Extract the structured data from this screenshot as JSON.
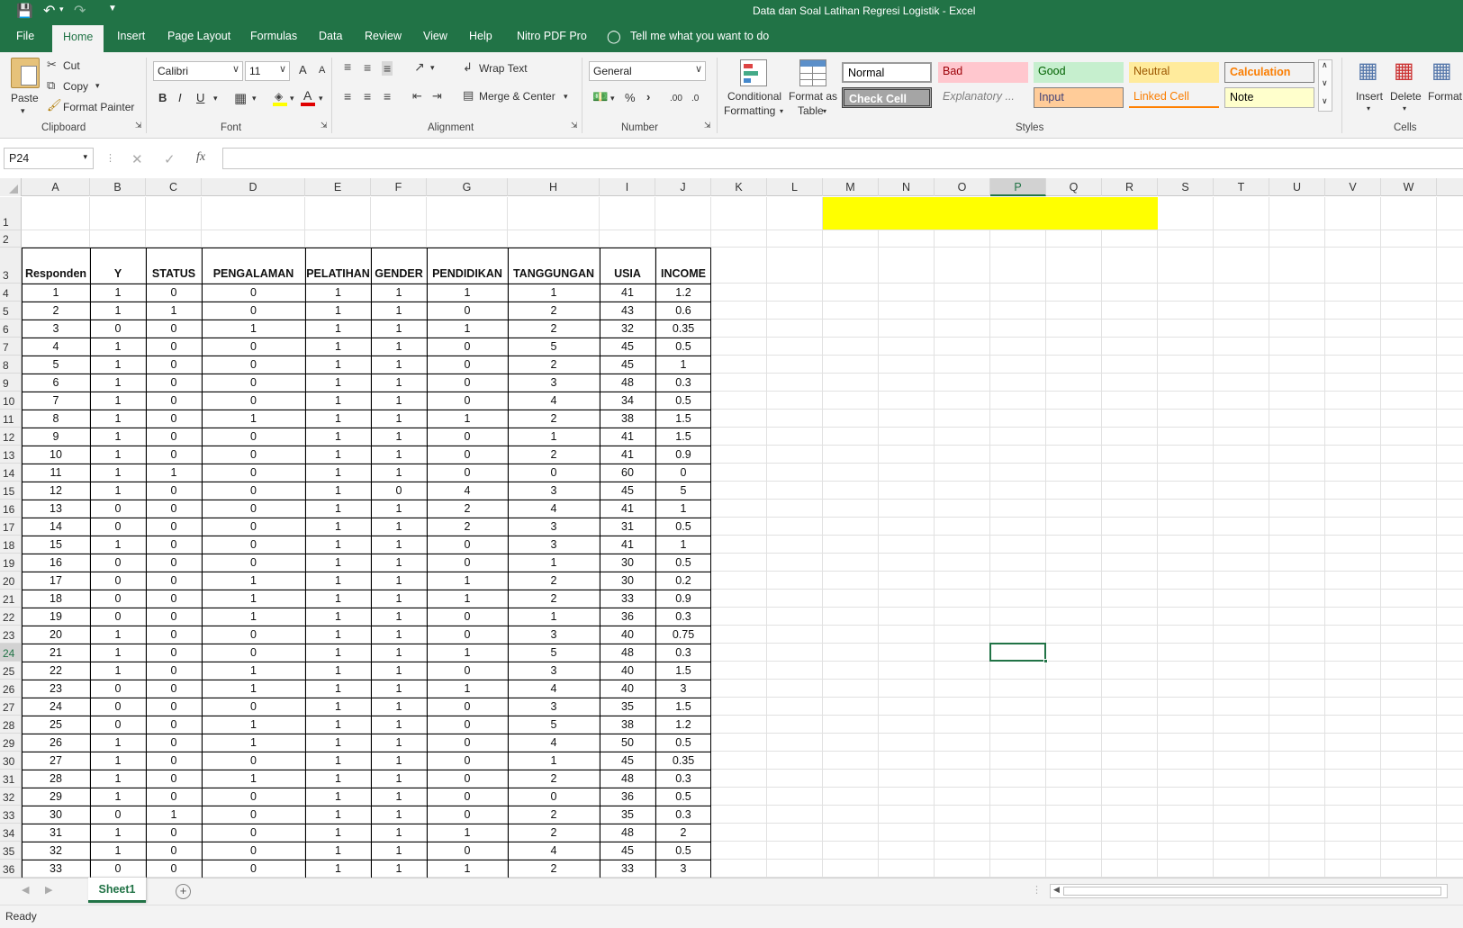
{
  "window": {
    "title": "Data dan Soal Latihan Regresi Logistik  -  Excel"
  },
  "menu": [
    "File",
    "Home",
    "Insert",
    "Page Layout",
    "Formulas",
    "Data",
    "Review",
    "View",
    "Help",
    "Nitro PDF Pro"
  ],
  "tell_me": "Tell me what you want to do",
  "clipboard": {
    "paste": "Paste",
    "cut": "Cut",
    "copy": "Copy",
    "format_painter": "Format Painter",
    "label": "Clipboard"
  },
  "font": {
    "name": "Calibri",
    "size": "11",
    "label": "Font",
    "bold": "B",
    "italic": "I",
    "underline": "U",
    "grow": "A",
    "shrink": "A",
    "color": "A"
  },
  "alignment": {
    "wrap": "Wrap Text",
    "merge": "Merge & Center",
    "label": "Alignment"
  },
  "number": {
    "format": "General",
    "label": "Number",
    "percent": "%",
    "comma": "›",
    "inc": ".00",
    "dec": ".0"
  },
  "styles": {
    "label": "Styles",
    "conditional": "Conditional",
    "conditional2": "Formatting",
    "format_table": "Format as",
    "format_table2": "Table",
    "cells": [
      "Normal",
      "Bad",
      "Good",
      "Neutral",
      "Calculation",
      "Check Cell",
      "Explanatory ...",
      "Input",
      "Linked Cell",
      "Note"
    ]
  },
  "cells_group": {
    "label": "Cells",
    "insert": "Insert",
    "delete": "Delete",
    "format": "Format"
  },
  "formula": {
    "namebox": "P24",
    "value": "",
    "fx": "fx"
  },
  "columns": [
    "A",
    "B",
    "C",
    "D",
    "E",
    "F",
    "G",
    "H",
    "I",
    "J",
    "K",
    "L",
    "M",
    "N",
    "O",
    "P",
    "Q",
    "R",
    "S",
    "T",
    "U",
    "V",
    "W"
  ],
  "selected_col": "P",
  "selected_row": "24",
  "headers": [
    "Responden",
    "Y",
    "STATUS",
    "PENGALAMAN",
    "PELATIHAN",
    "GENDER",
    "PENDIDIKAN",
    "TANGGUNGAN",
    "USIA",
    "INCOME"
  ],
  "rows": [
    [
      "1",
      "1",
      "0",
      "0",
      "1",
      "1",
      "1",
      "1",
      "41",
      "1.2"
    ],
    [
      "2",
      "1",
      "1",
      "0",
      "1",
      "1",
      "0",
      "2",
      "43",
      "0.6"
    ],
    [
      "3",
      "0",
      "0",
      "1",
      "1",
      "1",
      "1",
      "2",
      "32",
      "0.35"
    ],
    [
      "4",
      "1",
      "0",
      "0",
      "1",
      "1",
      "0",
      "5",
      "45",
      "0.5"
    ],
    [
      "5",
      "1",
      "0",
      "0",
      "1",
      "1",
      "0",
      "2",
      "45",
      "1"
    ],
    [
      "6",
      "1",
      "0",
      "0",
      "1",
      "1",
      "0",
      "3",
      "48",
      "0.3"
    ],
    [
      "7",
      "1",
      "0",
      "0",
      "1",
      "1",
      "0",
      "4",
      "34",
      "0.5"
    ],
    [
      "8",
      "1",
      "0",
      "1",
      "1",
      "1",
      "1",
      "2",
      "38",
      "1.5"
    ],
    [
      "9",
      "1",
      "0",
      "0",
      "1",
      "1",
      "0",
      "1",
      "41",
      "1.5"
    ],
    [
      "10",
      "1",
      "0",
      "0",
      "1",
      "1",
      "0",
      "2",
      "41",
      "0.9"
    ],
    [
      "11",
      "1",
      "1",
      "0",
      "1",
      "1",
      "0",
      "0",
      "60",
      "0"
    ],
    [
      "12",
      "1",
      "0",
      "0",
      "1",
      "0",
      "4",
      "3",
      "45",
      "5"
    ],
    [
      "13",
      "0",
      "0",
      "0",
      "1",
      "1",
      "2",
      "4",
      "41",
      "1"
    ],
    [
      "14",
      "0",
      "0",
      "0",
      "1",
      "1",
      "2",
      "3",
      "31",
      "0.5"
    ],
    [
      "15",
      "1",
      "0",
      "0",
      "1",
      "1",
      "0",
      "3",
      "41",
      "1"
    ],
    [
      "16",
      "0",
      "0",
      "0",
      "1",
      "1",
      "0",
      "1",
      "30",
      "0.5"
    ],
    [
      "17",
      "0",
      "0",
      "1",
      "1",
      "1",
      "1",
      "2",
      "30",
      "0.2"
    ],
    [
      "18",
      "0",
      "0",
      "1",
      "1",
      "1",
      "1",
      "2",
      "33",
      "0.9"
    ],
    [
      "19",
      "0",
      "0",
      "1",
      "1",
      "1",
      "0",
      "1",
      "36",
      "0.3"
    ],
    [
      "20",
      "1",
      "0",
      "0",
      "1",
      "1",
      "0",
      "3",
      "40",
      "0.75"
    ],
    [
      "21",
      "1",
      "0",
      "0",
      "1",
      "1",
      "1",
      "5",
      "48",
      "0.3"
    ],
    [
      "22",
      "1",
      "0",
      "1",
      "1",
      "1",
      "0",
      "3",
      "40",
      "1.5"
    ],
    [
      "23",
      "0",
      "0",
      "1",
      "1",
      "1",
      "1",
      "4",
      "40",
      "3"
    ],
    [
      "24",
      "0",
      "0",
      "0",
      "1",
      "1",
      "0",
      "3",
      "35",
      "1.5"
    ],
    [
      "25",
      "0",
      "0",
      "1",
      "1",
      "1",
      "0",
      "5",
      "38",
      "1.2"
    ],
    [
      "26",
      "1",
      "0",
      "1",
      "1",
      "1",
      "0",
      "4",
      "50",
      "0.5"
    ],
    [
      "27",
      "1",
      "0",
      "0",
      "1",
      "1",
      "0",
      "1",
      "45",
      "0.35"
    ],
    [
      "28",
      "1",
      "0",
      "1",
      "1",
      "1",
      "0",
      "2",
      "48",
      "0.3"
    ],
    [
      "29",
      "1",
      "0",
      "0",
      "1",
      "1",
      "0",
      "0",
      "36",
      "0.5"
    ],
    [
      "30",
      "0",
      "1",
      "0",
      "1",
      "1",
      "0",
      "2",
      "35",
      "0.3"
    ],
    [
      "31",
      "1",
      "0",
      "0",
      "1",
      "1",
      "1",
      "2",
      "48",
      "2"
    ],
    [
      "32",
      "1",
      "0",
      "0",
      "1",
      "1",
      "0",
      "4",
      "45",
      "0.5"
    ],
    [
      "33",
      "0",
      "0",
      "0",
      "1",
      "1",
      "1",
      "2",
      "33",
      "3"
    ]
  ],
  "row_numbers": [
    "1",
    "2",
    "3",
    "4",
    "5",
    "6",
    "7",
    "8",
    "9",
    "10",
    "11",
    "12",
    "13",
    "14",
    "15",
    "16",
    "17",
    "18",
    "19",
    "20",
    "21",
    "22",
    "23",
    "24",
    "25",
    "26",
    "27",
    "28",
    "29",
    "30",
    "31",
    "32",
    "33",
    "34",
    "35",
    "36"
  ],
  "sheet_tab": "Sheet1",
  "status": "Ready",
  "colors": {
    "excel_green": "#217346",
    "highlight_yellow": "#ffff00"
  }
}
